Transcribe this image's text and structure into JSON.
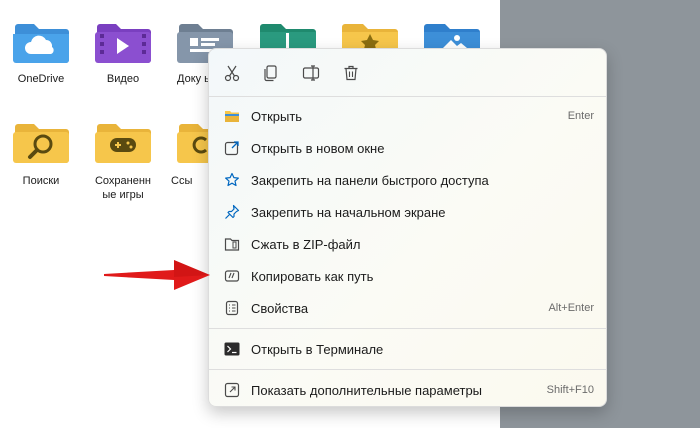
{
  "colors": {
    "folder": "#f6c64b",
    "blue_folder": "#3d8fd8",
    "purple_folder": "#8b4fd0",
    "teal_folder": "#2a9a7f",
    "accent": "#0067c0",
    "arrow": "#e01a1a"
  },
  "folders": [
    {
      "label": "OneDrive",
      "icon": "cloud-folder-icon"
    },
    {
      "label": "Видео",
      "icon": "video-folder-icon"
    },
    {
      "label": "Доку ы",
      "icon": "documents-folder-icon"
    },
    {
      "label": "",
      "icon": "downloads-folder-icon"
    },
    {
      "label": "",
      "icon": "favorites-folder-icon"
    },
    {
      "label": "",
      "icon": "pictures-folder-icon"
    },
    {
      "label": "Поиски",
      "icon": "searches-folder-icon"
    },
    {
      "label": "Сохраненн ые игры",
      "icon": "saved-games-folder-icon"
    },
    {
      "label": "Ссы",
      "icon": "links-folder-icon"
    }
  ],
  "context_menu": {
    "toolbar": [
      {
        "name": "cut",
        "icon": "scissors-icon"
      },
      {
        "name": "copy",
        "icon": "copy-icon"
      },
      {
        "name": "rename",
        "icon": "rename-icon"
      },
      {
        "name": "delete",
        "icon": "trash-icon"
      }
    ],
    "items": [
      {
        "label": "Открыть",
        "shortcut": "Enter",
        "icon": "folder-open-icon"
      },
      {
        "label": "Открыть в новом окне",
        "shortcut": "",
        "icon": "new-window-icon"
      },
      {
        "label": "Закрепить на панели быстрого доступа",
        "shortcut": "",
        "icon": "star-icon"
      },
      {
        "label": "Закрепить на начальном экране",
        "shortcut": "",
        "icon": "pin-icon"
      },
      {
        "label": "Сжать в ZIP-файл",
        "shortcut": "",
        "icon": "zip-icon"
      },
      {
        "label": "Копировать как путь",
        "shortcut": "",
        "icon": "copy-path-icon"
      },
      {
        "label": "Свойства",
        "shortcut": "Alt+Enter",
        "icon": "properties-icon"
      },
      {
        "label": "Открыть в Терминале",
        "shortcut": "",
        "icon": "terminal-icon"
      },
      {
        "label": "Показать дополнительные параметры",
        "shortcut": "Shift+F10",
        "icon": "more-options-icon"
      }
    ]
  }
}
